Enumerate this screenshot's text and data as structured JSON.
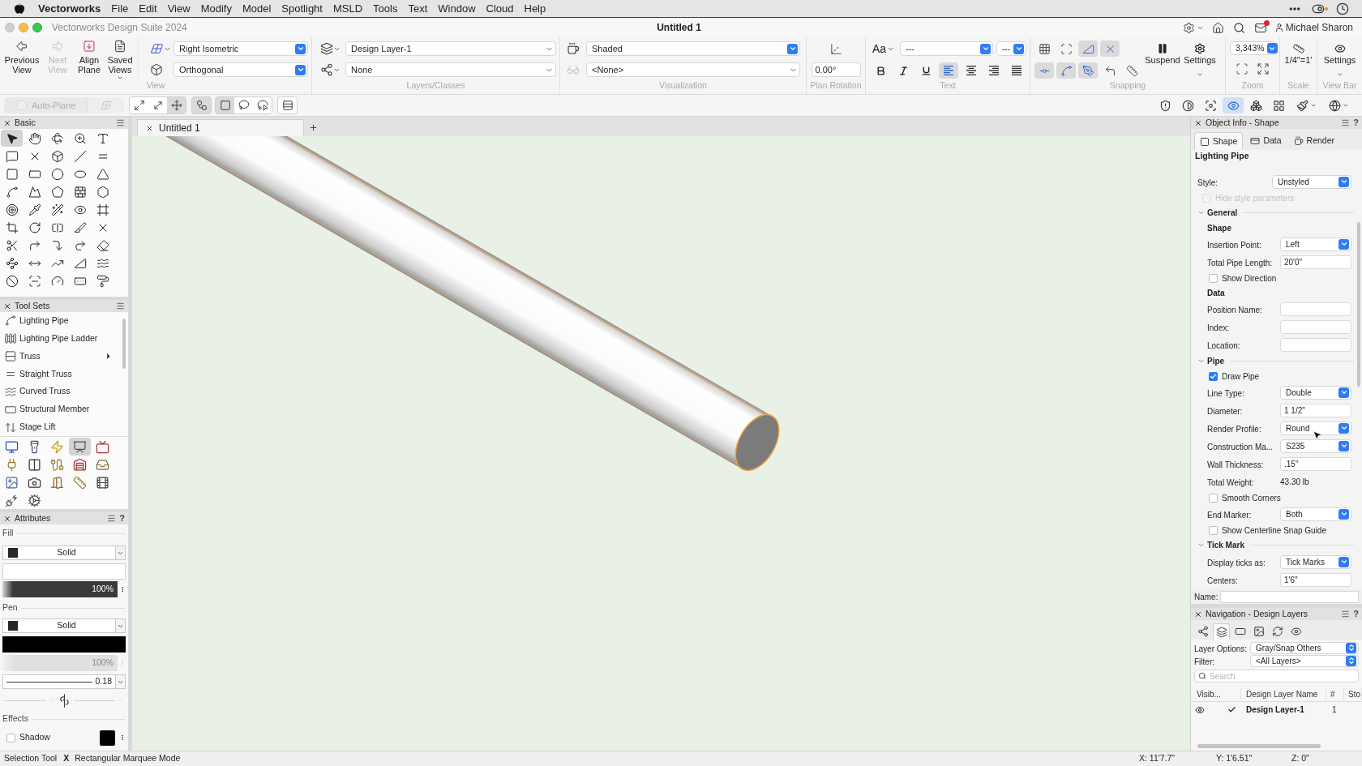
{
  "menu_bar": {
    "app": "Vectorworks",
    "menus": [
      "File",
      "Edit",
      "View",
      "Modify",
      "Model",
      "Spotlight",
      "MSLD",
      "Tools",
      "Text",
      "Window",
      "Cloud",
      "Help"
    ]
  },
  "window": {
    "app_name": "Vectorworks Design Suite 2024",
    "title": "Untitled 1",
    "user": "Michael Sharon",
    "mail_unread": true
  },
  "toolbar": {
    "view": {
      "label": "View",
      "buttons": [
        {
          "label": "Previous View",
          "disabled": false,
          "has_menu": false
        },
        {
          "label": "Next View",
          "disabled": true,
          "has_menu": false
        },
        {
          "label": "Align Plane",
          "disabled": false,
          "has_menu": false
        },
        {
          "label": "Saved Views",
          "disabled": false,
          "has_menu": true
        }
      ],
      "projection": "Right Isometric",
      "perspective": "Orthogonal"
    },
    "layers_classes": {
      "label": "Layers/Classes",
      "layer": "Design Layer-1",
      "class": "None"
    },
    "visualization": {
      "label": "Visualization",
      "render_mode": "Shaded",
      "style": "<None>"
    },
    "plan_rotation": {
      "label": "Plan Rotation",
      "value": "0.00°"
    },
    "text": {
      "label": "Text",
      "font_button": "Aa",
      "font": "---",
      "size": "---",
      "styles": [
        {
          "selected": false
        },
        {
          "selected": false
        },
        {
          "selected": false
        }
      ],
      "alignments": [
        {
          "selected": true
        },
        {
          "selected": false
        },
        {
          "selected": false
        },
        {
          "selected": false
        }
      ]
    },
    "snapping": {
      "label": "Snapping",
      "buttons": [
        {
          "on": false
        },
        {
          "on": false
        },
        {
          "on": true
        },
        {
          "on": true
        },
        {
          "on": true
        },
        {
          "on": true
        },
        {
          "on": true
        },
        {
          "on": false
        },
        {
          "on": false
        }
      ],
      "suspend": "Suspend",
      "settings": "Settings"
    },
    "zoom": {
      "label": "Zoom",
      "value": "3,343%"
    },
    "scale": {
      "label": "Scale",
      "value": "1/4\"=1'"
    },
    "view_bar": {
      "label": "View Bar",
      "settings": "Settings"
    }
  },
  "mode_bar": {
    "auto_plane": {
      "label": "Auto-Plane",
      "disabled": true
    },
    "groups": [
      [
        {
          "selected": false
        },
        {
          "selected": false
        },
        {
          "selected": true
        }
      ],
      [
        {
          "selected": true
        }
      ],
      [
        {
          "selected": true
        },
        {
          "selected": false
        },
        {
          "selected": false
        }
      ],
      [
        {
          "selected": false
        }
      ]
    ],
    "view_buttons": [
      {
        "selected": false
      },
      {
        "selected": false
      },
      {
        "selected": false
      },
      {
        "selected": true
      },
      {
        "selected": false
      },
      {
        "selected": false
      },
      {
        "selected": false
      },
      {
        "selected": false
      }
    ]
  },
  "basic": {
    "title": "Basic",
    "tools": [
      {
        "selected": true
      },
      {
        "selected": false
      },
      {
        "selected": false
      },
      {
        "selected": false
      },
      {
        "selected": false
      },
      {
        "selected": false
      },
      {
        "selected": false
      },
      {
        "selected": false
      },
      {
        "selected": false
      },
      {
        "selected": false
      },
      {
        "selected": false
      },
      {
        "selected": false
      },
      {
        "selected": false
      },
      {
        "selected": false
      },
      {
        "selected": false
      },
      {
        "selected": false
      },
      {
        "selected": false
      },
      {
        "selected": false
      },
      {
        "selected": false
      },
      {
        "selected": false
      },
      {
        "selected": false
      },
      {
        "selected": false
      },
      {
        "selected": false
      },
      {
        "selected": false
      },
      {
        "selected": false
      },
      {
        "selected": false
      },
      {
        "selected": false
      },
      {
        "selected": false
      },
      {
        "selected": false
      },
      {
        "selected": false
      },
      {
        "selected": false
      },
      {
        "selected": false
      },
      {
        "selected": false
      },
      {
        "selected": false
      },
      {
        "selected": false
      },
      {
        "selected": false
      },
      {
        "selected": false
      },
      {
        "selected": false
      },
      {
        "selected": false
      },
      {
        "selected": false
      },
      {
        "selected": false
      },
      {
        "selected": false
      },
      {
        "selected": false
      },
      {
        "selected": false
      },
      {
        "selected": false
      }
    ]
  },
  "tool_sets": {
    "title": "Tool Sets",
    "items": [
      {
        "label": "Lighting Pipe",
        "submenu": false
      },
      {
        "label": "Lighting Pipe Ladder",
        "submenu": false
      },
      {
        "label": "Truss",
        "submenu": true
      },
      {
        "label": "Straight Truss",
        "submenu": false
      },
      {
        "label": "Curved Truss",
        "submenu": false
      },
      {
        "label": "Structural Member",
        "submenu": false
      },
      {
        "label": "Stage Lift",
        "submenu": false
      }
    ],
    "groups": [
      {
        "selected": false
      },
      {
        "selected": false
      },
      {
        "selected": false
      },
      {
        "selected": true
      },
      {
        "selected": false
      },
      {
        "selected": false
      },
      {
        "selected": false
      },
      {
        "selected": false
      },
      {
        "selected": false
      },
      {
        "selected": false
      },
      {
        "selected": false
      },
      {
        "selected": false
      },
      {
        "selected": false
      },
      {
        "selected": false
      },
      {
        "selected": false
      },
      {
        "selected": false
      },
      {
        "selected": false
      }
    ]
  },
  "attributes": {
    "title": "Attributes",
    "help": "?",
    "fill": {
      "label": "Fill",
      "style": "Solid",
      "opacity": "100%",
      "level": 1,
      "disabled": false
    },
    "pen": {
      "label": "Pen",
      "style": "Solid",
      "opacity": "100%",
      "level": 1,
      "disabled": true,
      "thickness": "0.18",
      "markers_disabled": true
    },
    "effects": {
      "label": "Effects",
      "shadow": {
        "label": "Shadow",
        "checked": false
      }
    }
  },
  "document_tabs": [
    {
      "label": "Untitled 1",
      "selected": true
    }
  ],
  "object_info": {
    "title": "Object Info - Shape",
    "help": "?",
    "tabs": [
      {
        "label": "Shape",
        "selected": true
      },
      {
        "label": "Data",
        "selected": false
      },
      {
        "label": "Render",
        "selected": false
      }
    ],
    "object_type": "Lighting Pipe",
    "fields": [
      {
        "kind": "dropdown",
        "label": "Style:",
        "value": "Unstyled"
      },
      {
        "kind": "checkbox",
        "label": "Hide style parameters",
        "checked": false,
        "disabled": true
      },
      {
        "kind": "section",
        "label": "General",
        "expanded": true,
        "children": [
          {
            "kind": "heading",
            "label": "Shape"
          },
          {
            "kind": "dropdown",
            "label": "Insertion Point:",
            "value": "Left"
          },
          {
            "kind": "text",
            "label": "Total Pipe Length:",
            "value": "20'0\""
          },
          {
            "kind": "checkbox",
            "label": "Show Direction",
            "checked": false,
            "disabled": false
          },
          {
            "kind": "heading",
            "label": "Data"
          },
          {
            "kind": "text",
            "label": "Position Name:"
          },
          {
            "kind": "text",
            "label": "Index:"
          },
          {
            "kind": "text",
            "label": "Location:"
          }
        ]
      },
      {
        "kind": "section",
        "label": "Pipe",
        "expanded": true,
        "children": [
          {
            "kind": "checkbox",
            "label": "Draw Pipe",
            "checked": true,
            "disabled": false
          },
          {
            "kind": "dropdown",
            "label": "Line Type:",
            "value": "Double"
          },
          {
            "kind": "text",
            "label": "Diameter:",
            "value": "1 1/2\""
          },
          {
            "kind": "dropdown",
            "label": "Render Profile:",
            "value": "Round"
          },
          {
            "kind": "dropdown",
            "label": "Construction Ma...",
            "value": "S235"
          },
          {
            "kind": "text",
            "label": "Wall Thickness:",
            "value": ".15\""
          },
          {
            "kind": "static",
            "label": "Total Weight:",
            "value": "43.30 lb"
          },
          {
            "kind": "checkbox",
            "label": "Smooth Corners",
            "checked": false,
            "disabled": false
          },
          {
            "kind": "dropdown",
            "label": "End Marker:",
            "value": "Both"
          },
          {
            "kind": "checkbox",
            "label": "Show Centerline Snap Guide",
            "checked": false,
            "disabled": false
          }
        ]
      },
      {
        "kind": "section",
        "label": "Tick Mark",
        "expanded": true,
        "children": [
          {
            "kind": "dropdown",
            "label": "Display ticks as:",
            "value": "Tick Marks"
          },
          {
            "kind": "text",
            "label": "Centers:",
            "value": "1'6\""
          }
        ]
      }
    ],
    "name_label": "Name:"
  },
  "navigation": {
    "title": "Navigation - Design Layers",
    "help": "?",
    "tabs": [
      {
        "selected": false
      },
      {
        "selected": true
      },
      {
        "selected": false
      },
      {
        "selected": false
      },
      {
        "selected": false
      },
      {
        "selected": false
      }
    ],
    "layer_options": {
      "label": "Layer Options:",
      "value": "Gray/Snap Others"
    },
    "filter": {
      "label": "Filter:",
      "value": "<All Layers>"
    },
    "search": {
      "placeholder": "Search"
    },
    "table": {
      "columns": [
        "Visib...",
        "Design Layer Name",
        "#",
        "Sto"
      ],
      "rows": [
        {
          "visible": true,
          "active": true,
          "name": "Design Layer-1",
          "number": "1"
        }
      ]
    }
  },
  "status_bar": {
    "tool": "Selection Tool",
    "mode_mark": "X",
    "mode": "Rectangular Marquee Mode",
    "x": "X: 11'7.7\"",
    "y": "Y: 1'6.51\"",
    "z": "Z: 0\""
  }
}
